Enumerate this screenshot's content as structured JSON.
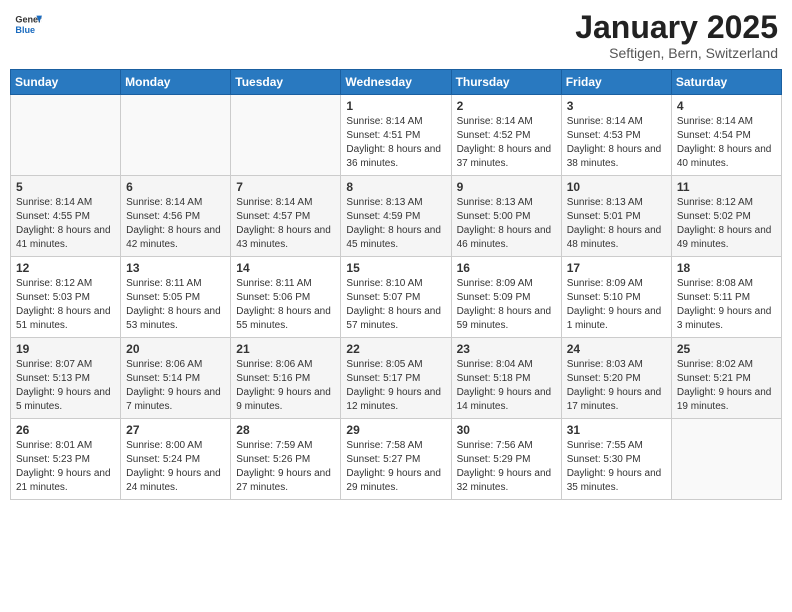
{
  "header": {
    "logo_general": "General",
    "logo_blue": "Blue",
    "month_year": "January 2025",
    "location": "Seftigen, Bern, Switzerland"
  },
  "days_of_week": [
    "Sunday",
    "Monday",
    "Tuesday",
    "Wednesday",
    "Thursday",
    "Friday",
    "Saturday"
  ],
  "weeks": [
    [
      {
        "day": "",
        "info": ""
      },
      {
        "day": "",
        "info": ""
      },
      {
        "day": "",
        "info": ""
      },
      {
        "day": "1",
        "info": "Sunrise: 8:14 AM\nSunset: 4:51 PM\nDaylight: 8 hours and 36 minutes."
      },
      {
        "day": "2",
        "info": "Sunrise: 8:14 AM\nSunset: 4:52 PM\nDaylight: 8 hours and 37 minutes."
      },
      {
        "day": "3",
        "info": "Sunrise: 8:14 AM\nSunset: 4:53 PM\nDaylight: 8 hours and 38 minutes."
      },
      {
        "day": "4",
        "info": "Sunrise: 8:14 AM\nSunset: 4:54 PM\nDaylight: 8 hours and 40 minutes."
      }
    ],
    [
      {
        "day": "5",
        "info": "Sunrise: 8:14 AM\nSunset: 4:55 PM\nDaylight: 8 hours and 41 minutes."
      },
      {
        "day": "6",
        "info": "Sunrise: 8:14 AM\nSunset: 4:56 PM\nDaylight: 8 hours and 42 minutes."
      },
      {
        "day": "7",
        "info": "Sunrise: 8:14 AM\nSunset: 4:57 PM\nDaylight: 8 hours and 43 minutes."
      },
      {
        "day": "8",
        "info": "Sunrise: 8:13 AM\nSunset: 4:59 PM\nDaylight: 8 hours and 45 minutes."
      },
      {
        "day": "9",
        "info": "Sunrise: 8:13 AM\nSunset: 5:00 PM\nDaylight: 8 hours and 46 minutes."
      },
      {
        "day": "10",
        "info": "Sunrise: 8:13 AM\nSunset: 5:01 PM\nDaylight: 8 hours and 48 minutes."
      },
      {
        "day": "11",
        "info": "Sunrise: 8:12 AM\nSunset: 5:02 PM\nDaylight: 8 hours and 49 minutes."
      }
    ],
    [
      {
        "day": "12",
        "info": "Sunrise: 8:12 AM\nSunset: 5:03 PM\nDaylight: 8 hours and 51 minutes."
      },
      {
        "day": "13",
        "info": "Sunrise: 8:11 AM\nSunset: 5:05 PM\nDaylight: 8 hours and 53 minutes."
      },
      {
        "day": "14",
        "info": "Sunrise: 8:11 AM\nSunset: 5:06 PM\nDaylight: 8 hours and 55 minutes."
      },
      {
        "day": "15",
        "info": "Sunrise: 8:10 AM\nSunset: 5:07 PM\nDaylight: 8 hours and 57 minutes."
      },
      {
        "day": "16",
        "info": "Sunrise: 8:09 AM\nSunset: 5:09 PM\nDaylight: 8 hours and 59 minutes."
      },
      {
        "day": "17",
        "info": "Sunrise: 8:09 AM\nSunset: 5:10 PM\nDaylight: 9 hours and 1 minute."
      },
      {
        "day": "18",
        "info": "Sunrise: 8:08 AM\nSunset: 5:11 PM\nDaylight: 9 hours and 3 minutes."
      }
    ],
    [
      {
        "day": "19",
        "info": "Sunrise: 8:07 AM\nSunset: 5:13 PM\nDaylight: 9 hours and 5 minutes."
      },
      {
        "day": "20",
        "info": "Sunrise: 8:06 AM\nSunset: 5:14 PM\nDaylight: 9 hours and 7 minutes."
      },
      {
        "day": "21",
        "info": "Sunrise: 8:06 AM\nSunset: 5:16 PM\nDaylight: 9 hours and 9 minutes."
      },
      {
        "day": "22",
        "info": "Sunrise: 8:05 AM\nSunset: 5:17 PM\nDaylight: 9 hours and 12 minutes."
      },
      {
        "day": "23",
        "info": "Sunrise: 8:04 AM\nSunset: 5:18 PM\nDaylight: 9 hours and 14 minutes."
      },
      {
        "day": "24",
        "info": "Sunrise: 8:03 AM\nSunset: 5:20 PM\nDaylight: 9 hours and 17 minutes."
      },
      {
        "day": "25",
        "info": "Sunrise: 8:02 AM\nSunset: 5:21 PM\nDaylight: 9 hours and 19 minutes."
      }
    ],
    [
      {
        "day": "26",
        "info": "Sunrise: 8:01 AM\nSunset: 5:23 PM\nDaylight: 9 hours and 21 minutes."
      },
      {
        "day": "27",
        "info": "Sunrise: 8:00 AM\nSunset: 5:24 PM\nDaylight: 9 hours and 24 minutes."
      },
      {
        "day": "28",
        "info": "Sunrise: 7:59 AM\nSunset: 5:26 PM\nDaylight: 9 hours and 27 minutes."
      },
      {
        "day": "29",
        "info": "Sunrise: 7:58 AM\nSunset: 5:27 PM\nDaylight: 9 hours and 29 minutes."
      },
      {
        "day": "30",
        "info": "Sunrise: 7:56 AM\nSunset: 5:29 PM\nDaylight: 9 hours and 32 minutes."
      },
      {
        "day": "31",
        "info": "Sunrise: 7:55 AM\nSunset: 5:30 PM\nDaylight: 9 hours and 35 minutes."
      },
      {
        "day": "",
        "info": ""
      }
    ]
  ]
}
